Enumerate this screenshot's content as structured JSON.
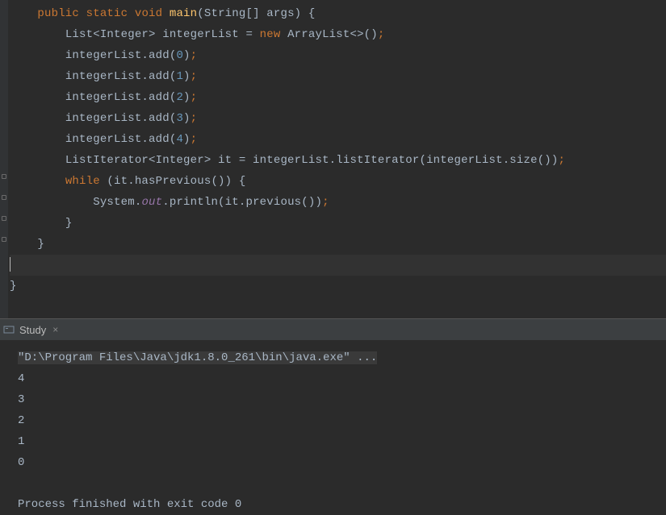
{
  "code": {
    "line1": {
      "indent": "    ",
      "public": "public",
      "static": "static",
      "void": "void",
      "main": "main",
      "params": "(String[] args) {"
    },
    "line2": {
      "indent": "        ",
      "decl": "List<Integer> integerList = ",
      "new": "new",
      "rest": " ArrayList<>()",
      "semi": ";"
    },
    "line3": {
      "indent": "        ",
      "text": "integerList.add(",
      "num": "0",
      "close": ")",
      "semi": ";"
    },
    "line4": {
      "indent": "        ",
      "text": "integerList.add(",
      "num": "1",
      "close": ")",
      "semi": ";"
    },
    "line5": {
      "indent": "        ",
      "text": "integerList.add(",
      "num": "2",
      "close": ")",
      "semi": ";"
    },
    "line6": {
      "indent": "        ",
      "text": "integerList.add(",
      "num": "3",
      "close": ")",
      "semi": ";"
    },
    "line7": {
      "indent": "        ",
      "text": "integerList.add(",
      "num": "4",
      "close": ")",
      "semi": ";"
    },
    "line8": {
      "indent": "        ",
      "text": "ListIterator<Integer> it = integerList.listIterator(integerList.size())",
      "semi": ";"
    },
    "line9": {
      "indent": "        ",
      "while": "while",
      "rest": " (it.hasPrevious()) {"
    },
    "line10": {
      "indent": "            ",
      "sys": "System.",
      "out": "out",
      "rest": ".println(it.previous())",
      "semi": ";"
    },
    "line11": {
      "indent": "        ",
      "brace": "}"
    },
    "line12": {
      "indent": "    ",
      "brace": "}"
    },
    "line13": {
      "brace": "}"
    }
  },
  "tab": {
    "label": "Study"
  },
  "console": {
    "cmd": "\"D:\\Program Files\\Java\\jdk1.8.0_261\\bin\\java.exe\" ...",
    "out1": "4",
    "out2": "3",
    "out3": "2",
    "out4": "1",
    "out5": "0",
    "exit": "Process finished with exit code 0"
  }
}
